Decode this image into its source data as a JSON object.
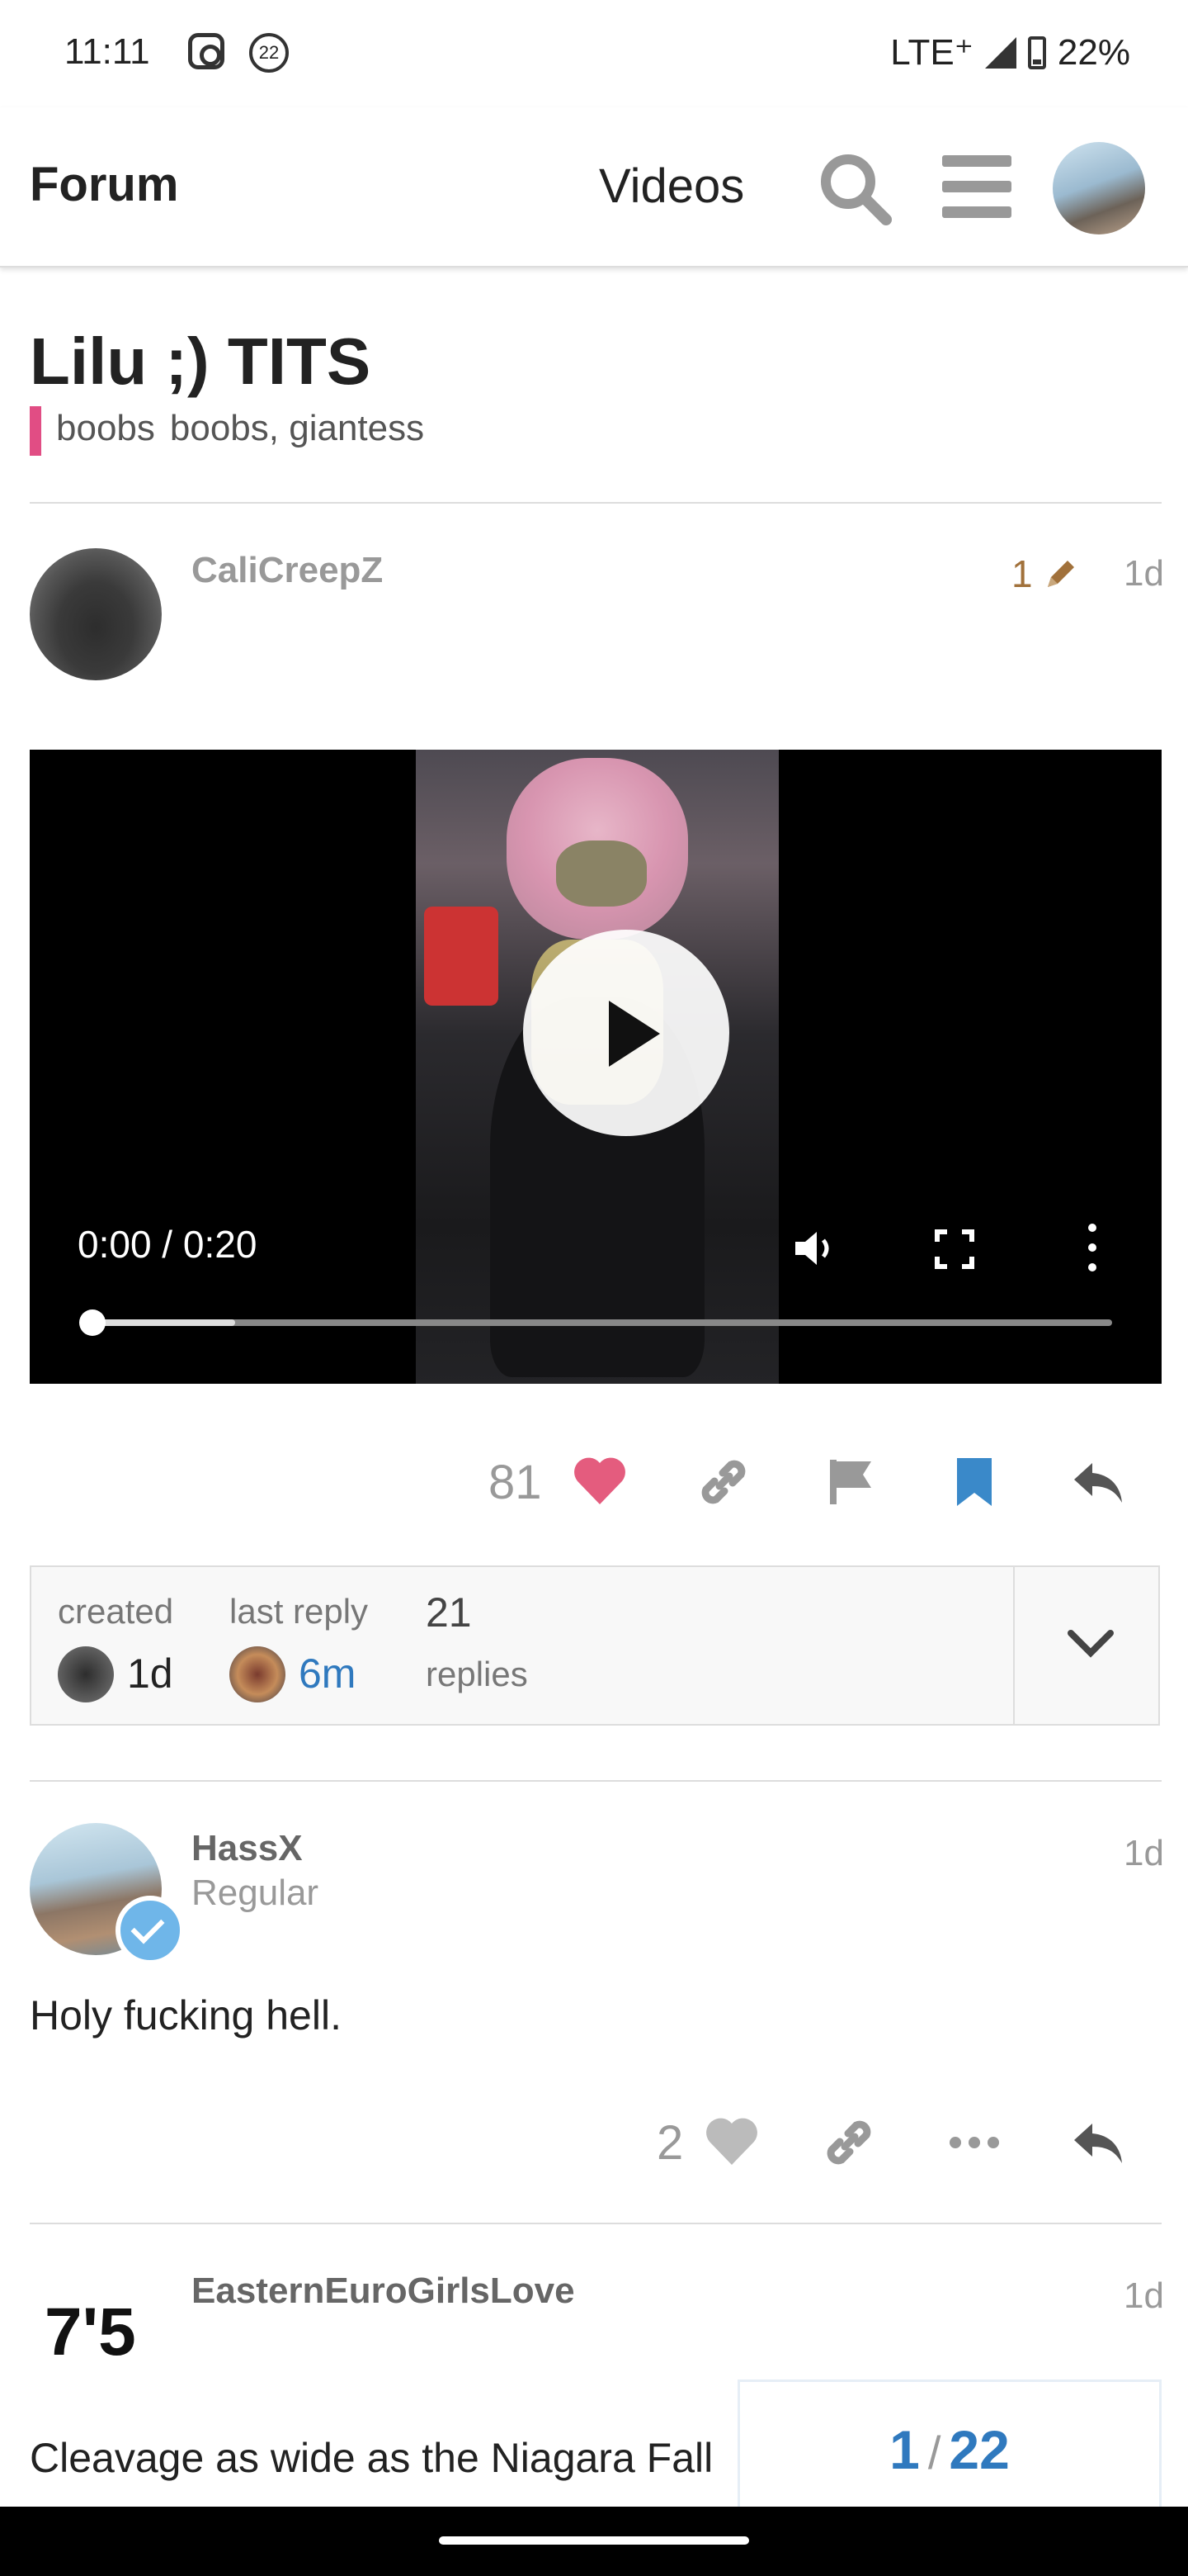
{
  "status_bar": {
    "time": "11:11",
    "notif_count": "22",
    "network": "LTE⁺",
    "battery": "22%"
  },
  "header": {
    "brand": "Forum",
    "nav_videos": "Videos",
    "icons": [
      "search-icon",
      "hamburger-menu-icon",
      "user-avatar"
    ]
  },
  "topic": {
    "title": "Lilu ;) TITS",
    "category_color": "#e14d84",
    "tags": [
      "boobs",
      "boobs, giantess"
    ]
  },
  "post1": {
    "username": "CaliCreepZ",
    "edit_count": "1",
    "age": "1d",
    "video": {
      "time": "0:00 / 0:20",
      "progress": 0,
      "buffered": 0.14
    },
    "likes": "81"
  },
  "topic_map": {
    "created_label": "created",
    "created_value": "1d",
    "last_reply_label": "last reply",
    "last_reply_value": "6m",
    "replies_count": "21",
    "replies_label": "replies"
  },
  "reply1": {
    "username": "HassX",
    "title": "Regular",
    "age": "1d",
    "text": "Holy fucking hell.",
    "likes": "2"
  },
  "reply2": {
    "avatar_text": "7'5",
    "username": "EasternEuroGirlsLove",
    "age": "1d",
    "text": "Cleavage as wide as the Niagara Fall"
  },
  "timeline": {
    "current": "1",
    "separator": "/",
    "total": "22"
  },
  "colors": {
    "link": "#2f79be",
    "heart": "#e45c7e",
    "bookmark": "#3a89c9"
  }
}
